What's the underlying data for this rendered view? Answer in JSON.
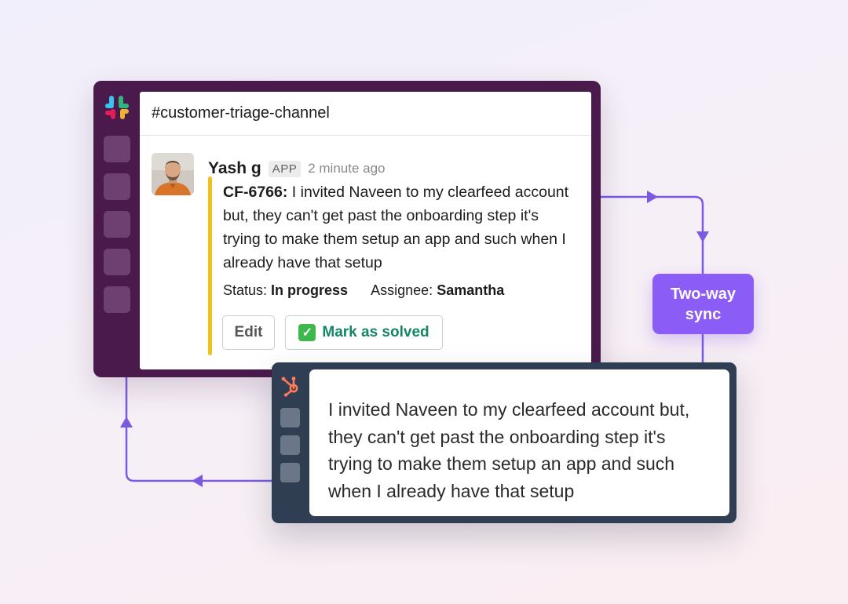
{
  "colors": {
    "slack_aubergine": "#4a1a4d",
    "hubspot_navy": "#2f3e52",
    "sync_purple": "#8b5cf6",
    "arrow_purple": "#7b5ae0",
    "accent_yellow": "#f3c01b",
    "solve_green": "#148567"
  },
  "slack": {
    "logo_icon": "slack-logo",
    "channel_name": "#customer-triage-channel",
    "message": {
      "sender": "Yash g",
      "badge": "APP",
      "timestamp": "2 minute ago",
      "ticket_id": "CF-6766:",
      "text": " I invited Naveen to my clearfeed account but, they can't get past the onboarding step it's trying to make them setup an app and such when I already have that setup",
      "status_label": "Status:",
      "status_value": "In progress",
      "assignee_label": "Assignee:",
      "assignee_value": "Samantha"
    },
    "actions": {
      "edit_label": "Edit",
      "solve_icon": "check-mark-button",
      "solve_label": "Mark as solved"
    }
  },
  "sync": {
    "line1": "Two-way",
    "line2": "sync"
  },
  "hubspot": {
    "logo_icon": "hubspot-sprocket",
    "ticket_text": "I invited Naveen to my clearfeed account but, they can't get past the onboarding step it's trying to make them setup an app and such when I already have that setup"
  }
}
